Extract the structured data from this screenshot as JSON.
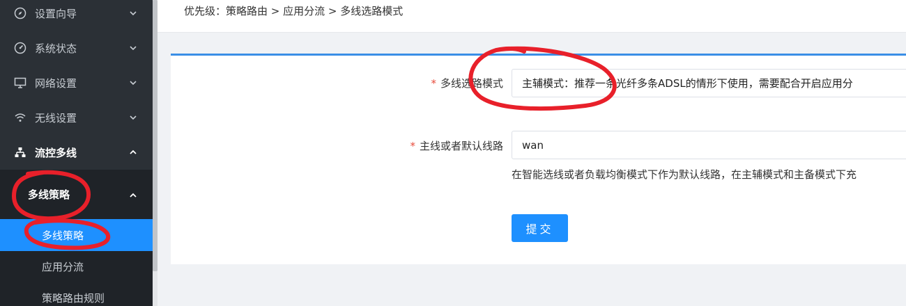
{
  "sidebar": {
    "items": [
      {
        "label": "设置向导",
        "icon": "compass-icon"
      },
      {
        "label": "系统状态",
        "icon": "gauge-icon"
      },
      {
        "label": "网络设置",
        "icon": "monitor-icon"
      },
      {
        "label": "无线设置",
        "icon": "wifi-icon"
      },
      {
        "label": "流控多线",
        "icon": "network-tree-icon"
      }
    ],
    "submenu": {
      "label": "多线策略",
      "children": [
        {
          "label": "多线策略",
          "active": true
        },
        {
          "label": "应用分流"
        },
        {
          "label": "策略路由规则"
        }
      ]
    }
  },
  "header": {
    "breadcrumb": "优先级：策略路由 > 应用分流 > 多线选路模式"
  },
  "form": {
    "mode_label": "多线选路模式",
    "mode_value": "主辅模式：推荐一条光纤多条ADSL的情形下使用，需要配合开启应用分",
    "line_label": "主线或者默认线路",
    "line_value": "wan",
    "line_help": "在智能选线或者负载均衡模式下作为默认线路，在主辅模式和主备模式下充",
    "submit_label": "提交"
  },
  "colors": {
    "sidebar_bg": "#2b3036",
    "active": "#1e90ff",
    "annotation": "#e8202a"
  }
}
